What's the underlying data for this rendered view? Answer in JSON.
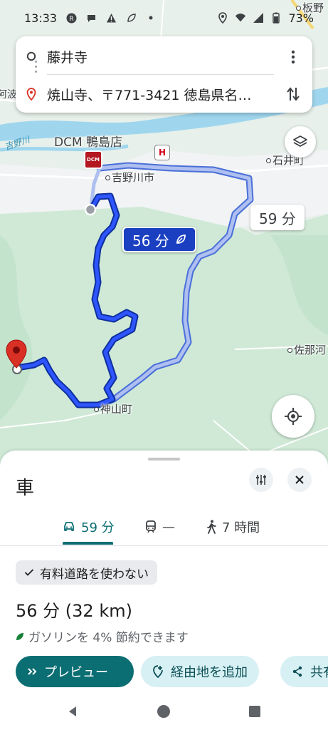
{
  "status_bar": {
    "time": "13:33",
    "battery": "73%",
    "icons": [
      "notification-icon",
      "chat-icon",
      "warning-icon",
      "leaf-icon",
      "location-icon",
      "wifi-icon",
      "signal-icon",
      "battery-icon"
    ]
  },
  "search": {
    "origin": "藤井寺",
    "destination": "焼山寺、〒771-3421 徳島県名…"
  },
  "map": {
    "labels": {
      "dcm_store": "DCM 鴨島店",
      "yoshinogawa": "吉野川市",
      "yoshinogawa_river": "吉野川",
      "ishii": "石井町",
      "kamiyama": "神山町",
      "sanagochi": "佐那河",
      "top_right": "板野",
      "left_edge": "阿波"
    },
    "dcm_logo_text": "DCM",
    "honda_logo_text": "H",
    "primary_route_time": "56 分",
    "alt_route_time": "59 分",
    "route_color": "#1a3fc1",
    "alt_route_color": "#8fa8e8",
    "destination_pin_color": "#d93025"
  },
  "sheet": {
    "title": "車",
    "tabs": [
      {
        "label": "59 分",
        "icon": "car-icon"
      },
      {
        "label": "—",
        "icon": "train-icon"
      },
      {
        "label": "7 時間",
        "icon": "walk-icon"
      }
    ],
    "avoid_chip": "有料道路を使わない",
    "route_summary": "56 分 (32 km)",
    "eco_note": "ガソリンを 4% 節約できます",
    "actions": {
      "preview": "プレビュー",
      "add_stop": "経由地を追加",
      "share": "共有"
    }
  },
  "accent_color": "#0b6e73"
}
